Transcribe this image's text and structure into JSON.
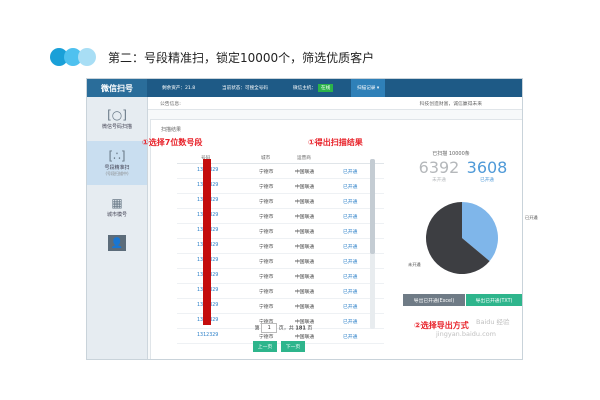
{
  "headline": {
    "text": "第二：号段精准扫，锁定10000个，筛选优质客户"
  },
  "app": {
    "brand": "微信扫号",
    "topbar": {
      "balance": "剩余资产：21.8",
      "status_label": "当前状态：可搜全号码",
      "host_label": "微信主机：",
      "host_status": "在线",
      "menu": "扫描记录 ▾"
    },
    "sidebar": {
      "items": [
        {
          "icon": "[○]",
          "label": "微信号码扫描",
          "sub": ""
        },
        {
          "icon": "[∴]",
          "label": "号段精准扫",
          "sub": "(号段扫描中)"
        },
        {
          "icon": "▦",
          "label": "城市模号",
          "sub": ""
        }
      ],
      "avatar_icon": "👤"
    },
    "notice": {
      "left": "公告信息:",
      "right": "科技创造财富，诚信赢得未来"
    },
    "panel_title": "扫描结果",
    "table": {
      "headers": [
        "号码",
        "城市",
        "运营商",
        ""
      ],
      "rows": [
        {
          "phone": "1312329",
          "city": "宁德市",
          "operator": "中国联通",
          "status": "已开通"
        },
        {
          "phone": "1312329",
          "city": "宁德市",
          "operator": "中国联通",
          "status": "已开通"
        },
        {
          "phone": "1312329",
          "city": "宁德市",
          "operator": "中国联通",
          "status": "已开通"
        },
        {
          "phone": "1312329",
          "city": "宁德市",
          "operator": "中国联通",
          "status": "已开通"
        },
        {
          "phone": "1312329",
          "city": "宁德市",
          "operator": "中国联通",
          "status": "已开通"
        },
        {
          "phone": "1312329",
          "city": "宁德市",
          "operator": "中国联通",
          "status": "已开通"
        },
        {
          "phone": "1312329",
          "city": "宁德市",
          "operator": "中国联通",
          "status": "已开通"
        },
        {
          "phone": "1312329",
          "city": "宁德市",
          "operator": "中国联通",
          "status": "已开通"
        },
        {
          "phone": "1312329",
          "city": "宁德市",
          "operator": "中国联通",
          "status": "已开通"
        },
        {
          "phone": "1312329",
          "city": "宁德市",
          "operator": "中国联通",
          "status": "已开通"
        },
        {
          "phone": "1312329",
          "city": "宁德市",
          "operator": "中国联通",
          "status": "已开通"
        },
        {
          "phone": "1312329",
          "city": "宁德市",
          "operator": "中国联通",
          "status": "已开通"
        }
      ]
    },
    "pager": {
      "prefix": "第",
      "page": "1",
      "middle": "页，共",
      "total": "181",
      "suffix": "页"
    },
    "buttons": {
      "prev": "上一页",
      "next": "下一页",
      "export_excel": "导出已开通(Excel)",
      "export_txt": "导出已开通(TXT)"
    },
    "stats": {
      "title": "已扫描 10000条",
      "left_num": "6392",
      "left_label": "未开通",
      "right_num": "3608",
      "right_label": "已开通",
      "left_color": "#b5b8bb",
      "right_color": "#4f9ad8"
    },
    "pie": {
      "label_right": "已开通",
      "label_left": "未开通",
      "slices": [
        {
          "value": 3608,
          "color": "#7fb6ea"
        },
        {
          "value": 6392,
          "color": "#3d3e42"
        }
      ]
    }
  },
  "annotations": {
    "select": "①选择7位数号段",
    "result": "①得出扫描结果",
    "export": "②选择导出方式",
    "color": "#e8222a"
  },
  "watermark": {
    "line1": "Baidu 经验",
    "line2": "jingyan.baidu.com"
  }
}
